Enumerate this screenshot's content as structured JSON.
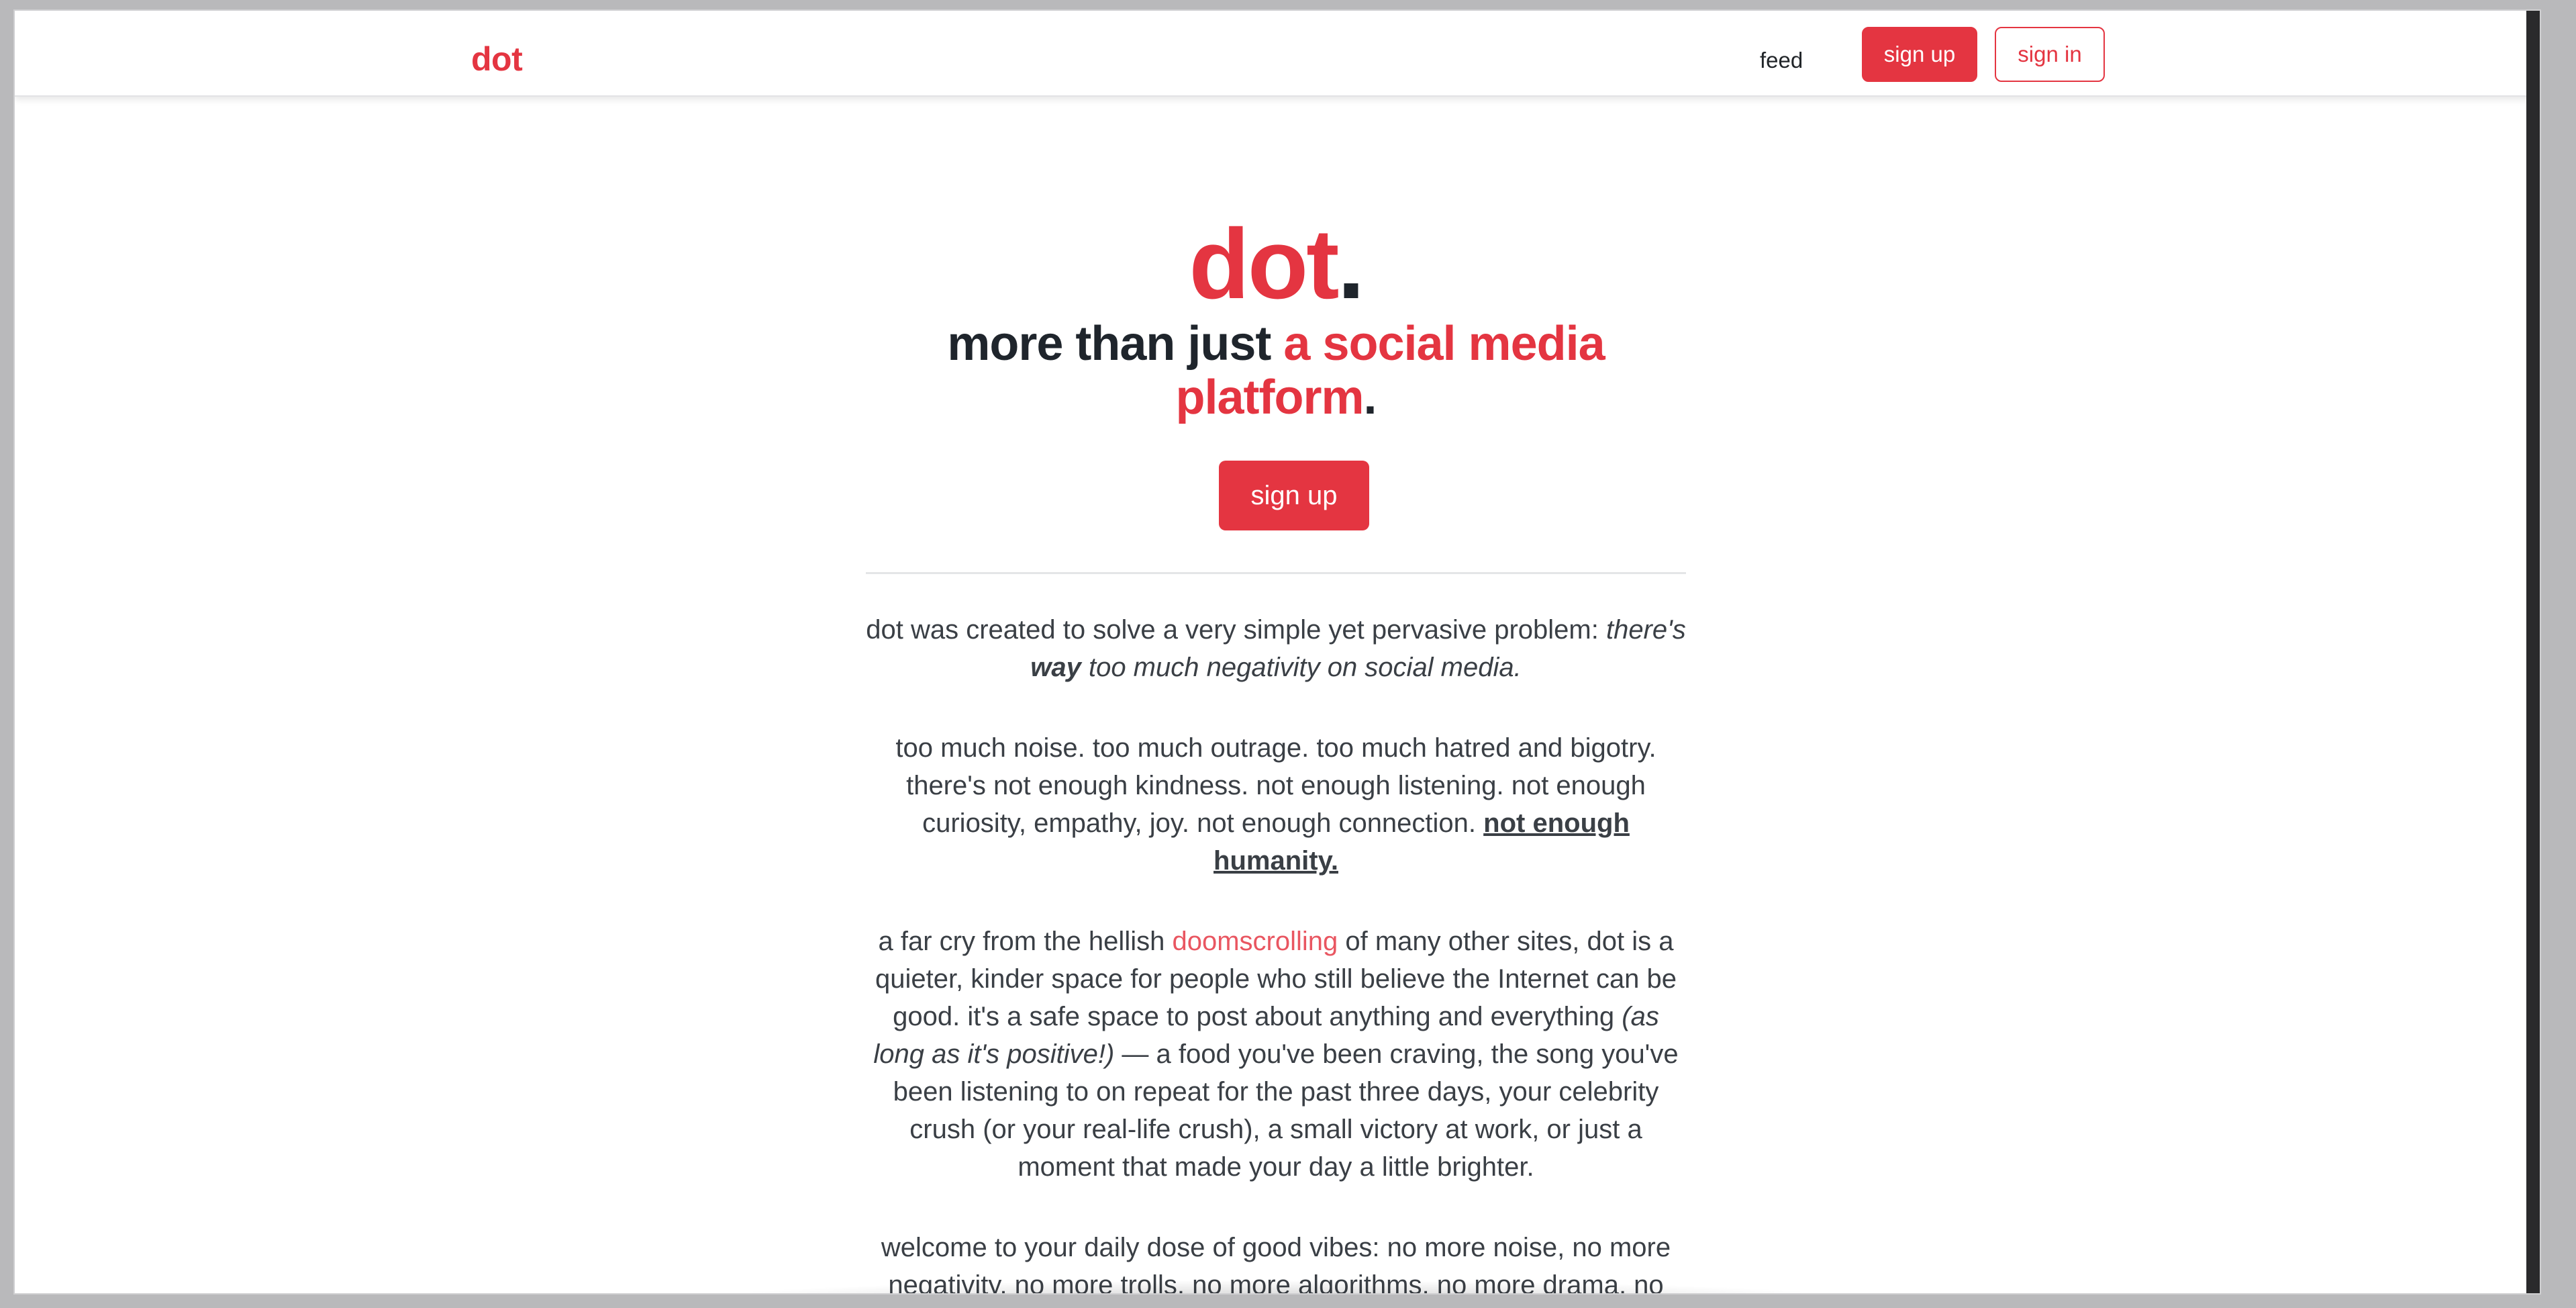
{
  "navbar": {
    "brand": "dot",
    "feed": "feed",
    "sign_up": "sign up",
    "sign_in": "sign in"
  },
  "hero": {
    "title": "dot",
    "title_period": ".",
    "subtitle_dark": "more than just ",
    "subtitle_accent": "a social media platform",
    "subtitle_period": ".",
    "button": "sign up"
  },
  "paragraphs": {
    "p1_a": "dot was created to solve a very simple yet pervasive problem: ",
    "p1_b_italic": "there's ",
    "p1_c_bold_italic": "way",
    "p1_d_italic": " too much negativity on social media.",
    "p2_a": "too much noise. too much outrage. too much hatred and bigotry. there's not enough kindness. not enough listening. not enough curiosity, empathy, joy. not enough connection. ",
    "p2_b_bold_underline": "not enough humanity.",
    "p3_a": "a far cry from the hellish ",
    "p3_link": "doomscrolling",
    "p3_b": " of many other sites, dot is a quieter, kinder space for people who still believe the Internet can be good. it's a safe space to post about anything and everything ",
    "p3_italic": "(as long as it's positive!)",
    "p3_c": " — a food you've been craving, the song you've been listening to on repeat for the past three days, your celebrity crush (or your real-life crush), a small victory at work, or just a moment that made your day a little brighter.",
    "p4": "welcome to your daily dose of good vibes: no more noise, no more negativity, no more trolls, no more algorithms, no more drama, no"
  },
  "colors": {
    "accent": "#e43541",
    "text": "#3a3f45",
    "heading": "#1f252c"
  }
}
